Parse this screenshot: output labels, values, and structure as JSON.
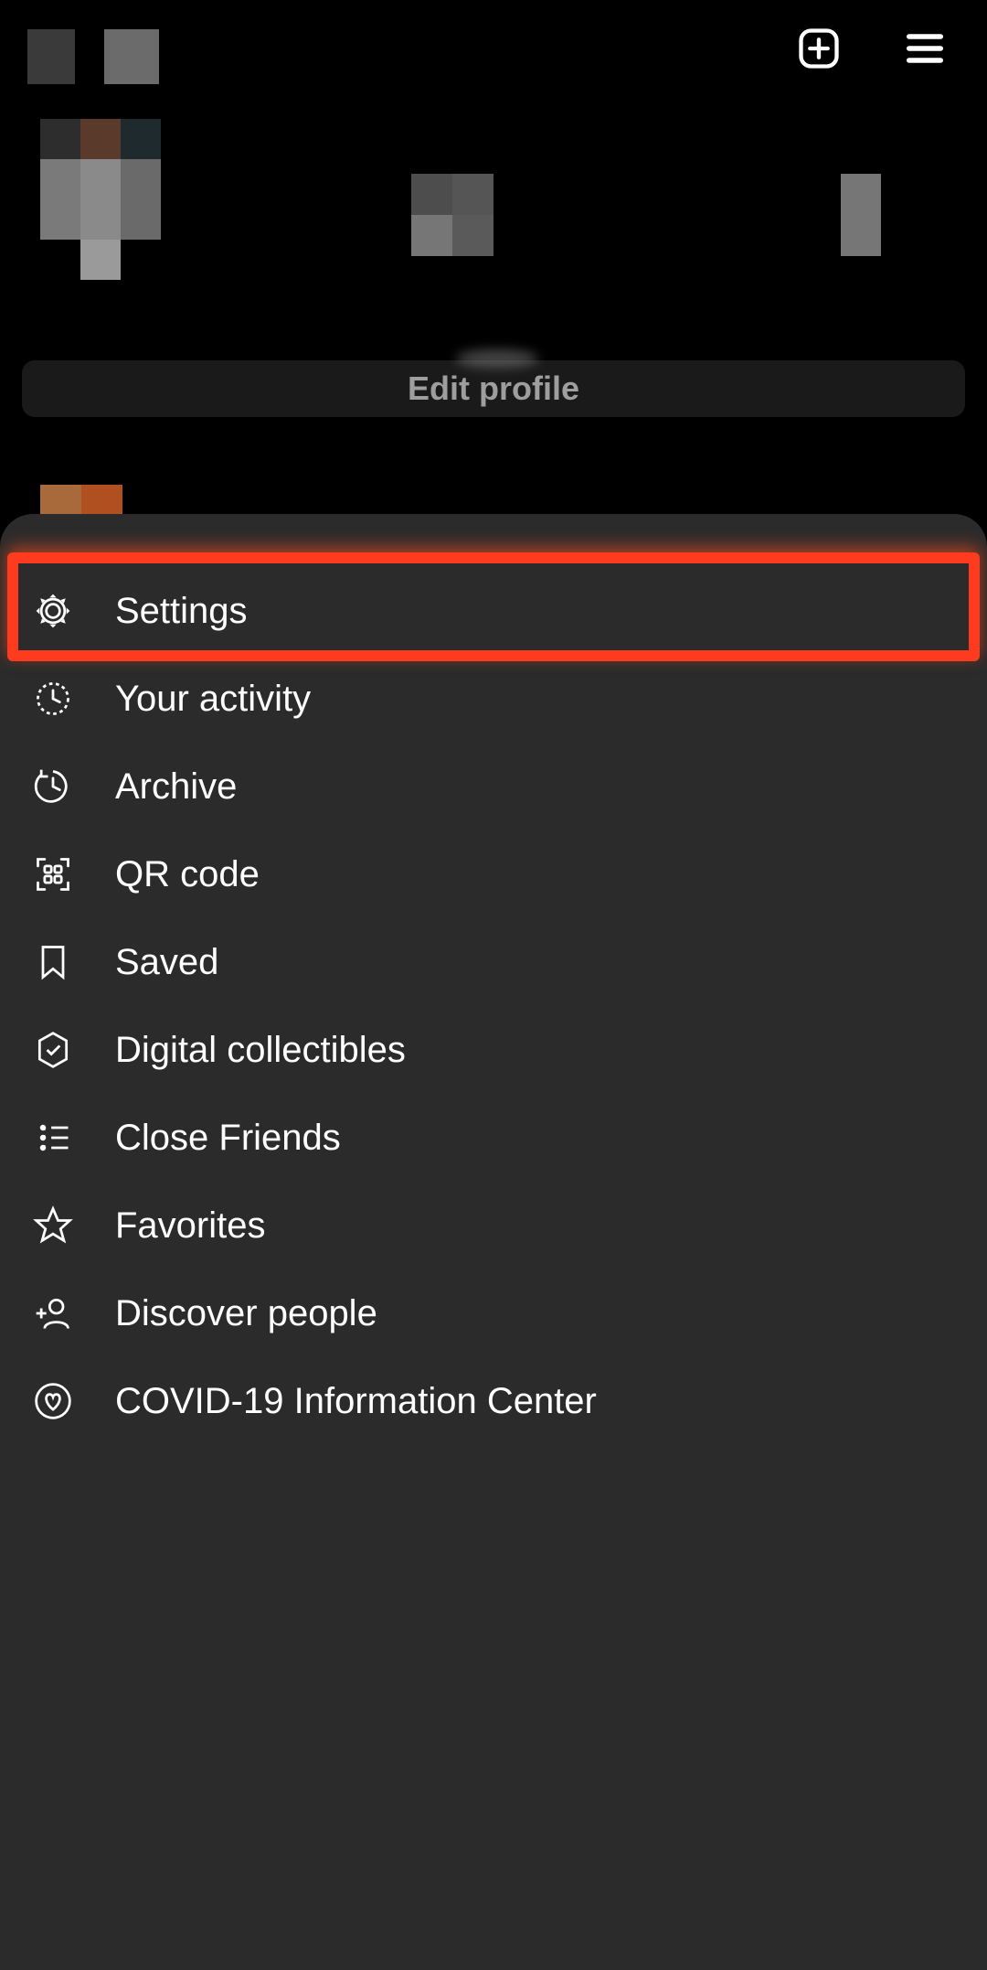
{
  "header": {
    "create_tooltip": "Create",
    "menu_tooltip": "Menu"
  },
  "profile": {
    "edit_label": "Edit profile"
  },
  "sheet": {
    "items": [
      {
        "id": "settings",
        "label": "Settings",
        "icon": "gear-icon"
      },
      {
        "id": "activity",
        "label": "Your activity",
        "icon": "activity-icon"
      },
      {
        "id": "archive",
        "label": "Archive",
        "icon": "archive-icon"
      },
      {
        "id": "qrcode",
        "label": "QR code",
        "icon": "qr-icon"
      },
      {
        "id": "saved",
        "label": "Saved",
        "icon": "bookmark-icon"
      },
      {
        "id": "collectibles",
        "label": "Digital collectibles",
        "icon": "verified-icon"
      },
      {
        "id": "closefriends",
        "label": "Close Friends",
        "icon": "close-friends-icon"
      },
      {
        "id": "favorites",
        "label": "Favorites",
        "icon": "star-icon"
      },
      {
        "id": "discover",
        "label": "Discover people",
        "icon": "add-person-icon"
      },
      {
        "id": "covid",
        "label": "COVID-19 Information Center",
        "icon": "heart-badge-icon"
      }
    ]
  },
  "annotation": {
    "highlighted_item_index": 0,
    "color": "#ff3b1f"
  }
}
